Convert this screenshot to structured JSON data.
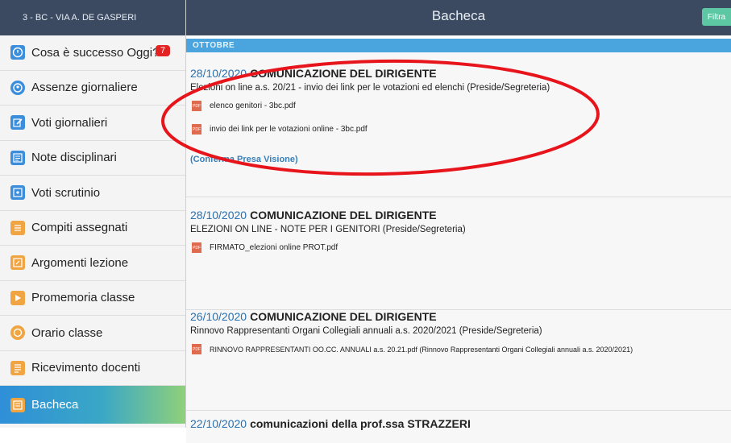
{
  "sidebar": {
    "header": "3 - BC - VIA A. DE GASPERI",
    "items": [
      {
        "label": "Cosa è successo Oggi?",
        "icon": "clock-icon",
        "badge": "7",
        "color": "#3a8edb"
      },
      {
        "label": "Assenze giornaliere",
        "icon": "person-icon",
        "color": "#3a8edb"
      },
      {
        "label": "Voti giornalieri",
        "icon": "edit-icon",
        "color": "#3a8edb"
      },
      {
        "label": "Note disciplinari",
        "icon": "notes-icon",
        "color": "#3a8edb"
      },
      {
        "label": "Voti scrutinio",
        "icon": "report-icon",
        "color": "#3a8edb"
      },
      {
        "label": "Compiti assegnati",
        "icon": "tasks-icon",
        "color": "#f0a542"
      },
      {
        "label": "Argomenti lezione",
        "icon": "book-icon",
        "color": "#f0a542"
      },
      {
        "label": "Promemoria classe",
        "icon": "play-icon",
        "color": "#f0a542"
      },
      {
        "label": "Orario classe",
        "icon": "timetable-icon",
        "color": "#f0a542"
      },
      {
        "label": "Ricevimento docenti",
        "icon": "calendar-icon",
        "color": "#f0a542"
      },
      {
        "label": "Bacheca",
        "icon": "board-icon",
        "color": "#f0a542"
      }
    ]
  },
  "topbar": {
    "title": "Bacheca",
    "filter_label": "Filtra"
  },
  "month_label": "OTTOBRE",
  "cards": [
    {
      "date": "28/10/2020",
      "kind": "COMUNICAZIONE DEL DIRIGENTE",
      "subject": "Elezioni on line a.s. 20/21 - invio dei link per le votazioni ed elenchi (Preside/Segreteria)",
      "attachments": [
        "elenco genitori - 3bc.pdf",
        "invio dei link per le votazioni online - 3bc.pdf"
      ],
      "confirm": "(Conferma Presa Visione)"
    },
    {
      "date": "28/10/2020",
      "kind": "COMUNICAZIONE DEL DIRIGENTE",
      "subject": "ELEZIONI ON LINE - NOTE PER I GENITORI (Preside/Segreteria)",
      "attachments": [
        "FIRMATO_elezioni online PROT.pdf"
      ]
    },
    {
      "date": "26/10/2020",
      "kind": "COMUNICAZIONE DEL DIRIGENTE",
      "subject": "Rinnovo Rappresentanti Organi Collegiali annuali a.s. 2020/2021 (Preside/Segreteria)",
      "attachments": [
        "RINNOVO RAPPRESENTANTI OO.CC. ANNUALI a.s. 20.21.pdf (Rinnovo Rappresentanti Organi Collegiali annuali a.s. 2020/2021)"
      ]
    },
    {
      "date": "22/10/2020",
      "kind": "comunicazioni della prof.ssa STRAZZERI"
    }
  ],
  "pdf_icon_label": "PDF",
  "annotation_color": "#e8141b"
}
